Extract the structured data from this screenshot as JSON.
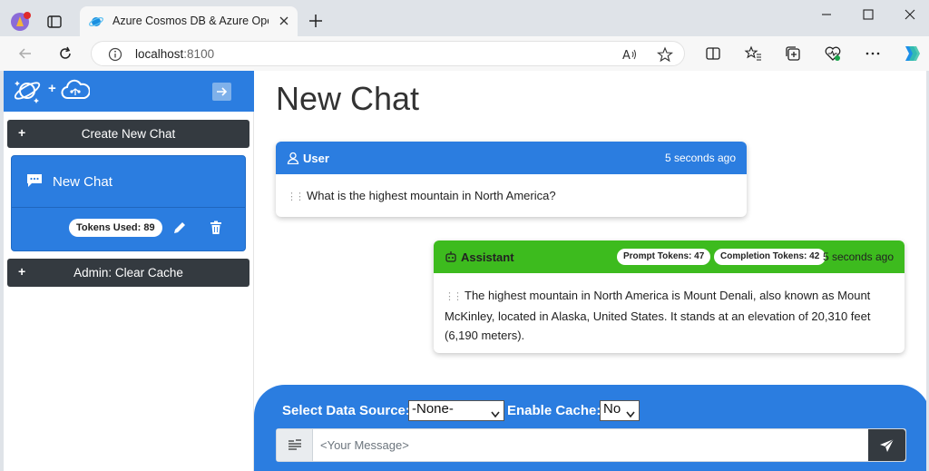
{
  "browser": {
    "tab_title": "Azure Cosmos DB & Azure OpenAI",
    "url_host": "localhost",
    "url_port": ":8100"
  },
  "sidebar": {
    "logo_plus": "+",
    "create_button": "Create New Chat",
    "chats": [
      {
        "title": "New Chat",
        "tokens_label": "Tokens Used: 89"
      }
    ],
    "clear_cache_button": "Admin: Clear Cache"
  },
  "main": {
    "title": "New Chat",
    "messages": [
      {
        "role": "User",
        "time": "5 seconds ago",
        "text": "What is the highest mountain in North America?",
        "color": "#2b7de0"
      },
      {
        "role": "Assistant",
        "time": "5 seconds ago",
        "prompt_tokens": "Prompt Tokens: 47",
        "completion_tokens": "Completion Tokens: 42",
        "text": "The highest mountain in North America is Mount Denali, also known as Mount McKinley, located in Alaska, United States. It stands at an elevation of 20,310 feet (6,190 meters).",
        "color": "#3dbb1e"
      }
    ]
  },
  "composer": {
    "data_source_label": "Select Data Source:",
    "data_source_value": "-None-",
    "cache_label": "Enable Cache:",
    "cache_value": "No",
    "placeholder": "<Your Message>"
  },
  "colors": {
    "accent": "#2b7de0",
    "dark": "#343a40",
    "assistant": "#3dbb1e"
  },
  "icons": [
    "edge-profile-icon",
    "tab-actions-icon",
    "cosmos-favicon",
    "close-icon",
    "plus-icon",
    "minimize-icon",
    "maximize-icon",
    "window-close-icon",
    "back-icon",
    "refresh-icon",
    "info-icon",
    "read-aloud-icon",
    "favorite-icon",
    "split-screen-icon",
    "favorites-icon",
    "collections-icon",
    "browser-essentials-icon",
    "more-icon",
    "copilot-icon",
    "cosmos-logo-icon",
    "openai-cloud-icon",
    "collapse-icon",
    "chat-bubble-icon",
    "pencil-icon",
    "trash-icon",
    "user-icon",
    "robot-icon",
    "text-icon",
    "send-icon"
  ]
}
